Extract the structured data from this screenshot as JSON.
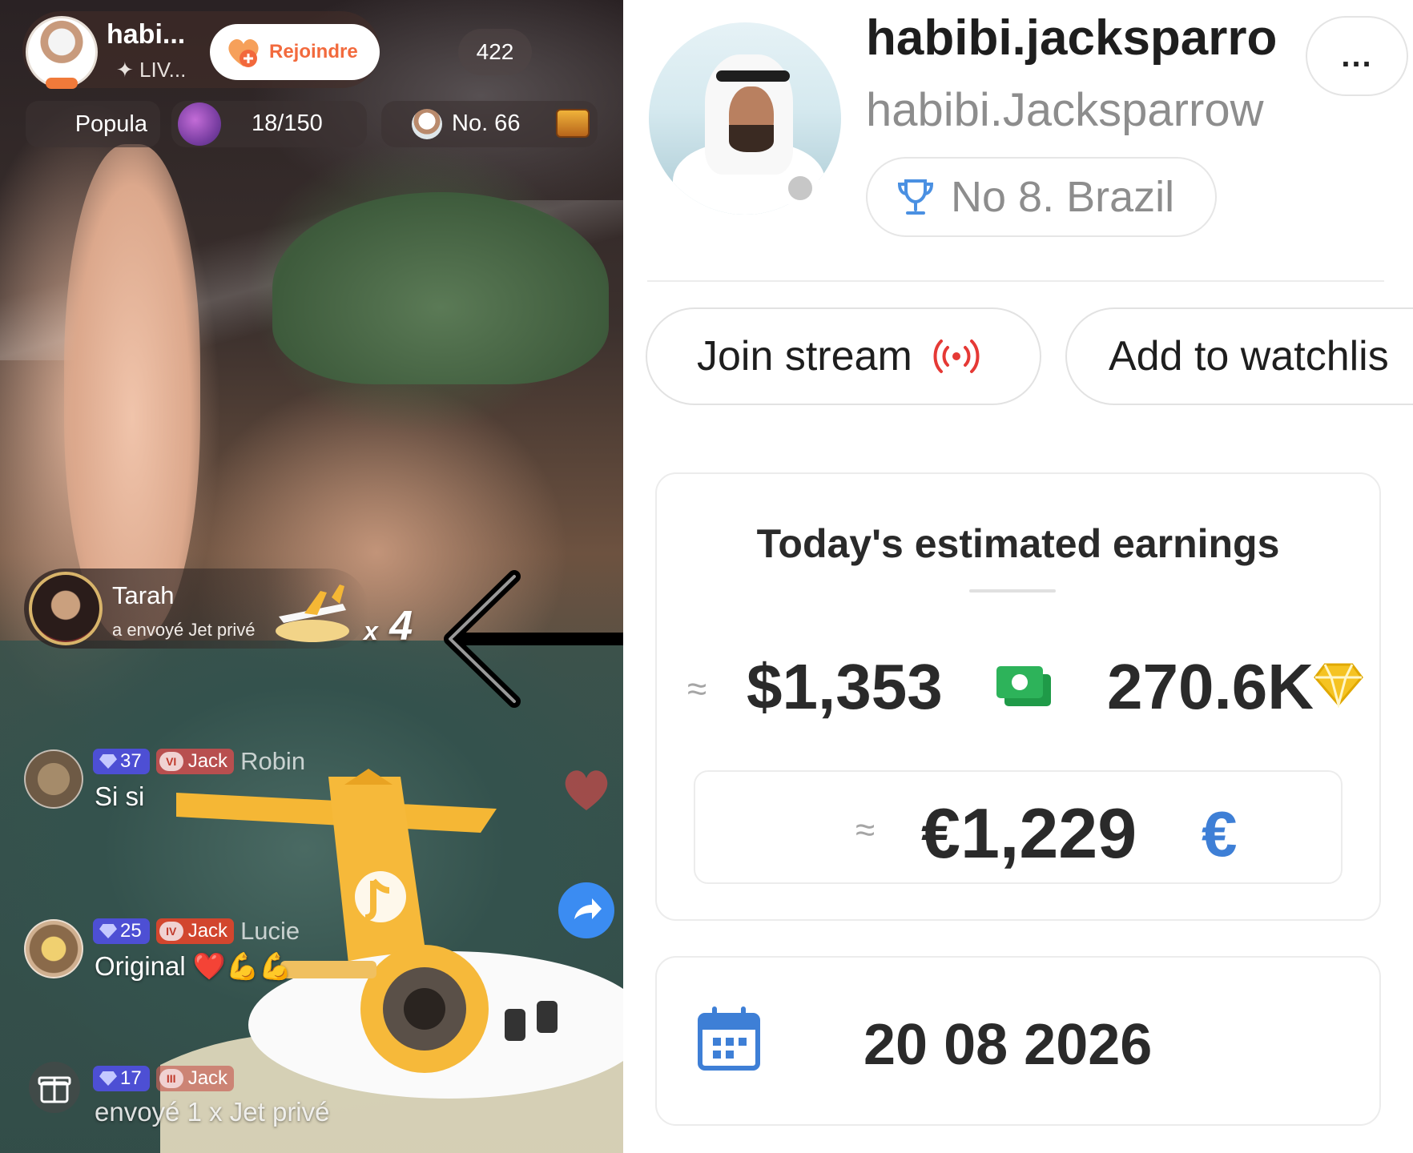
{
  "live": {
    "host_name": "habi...",
    "host_sub": "LIV...",
    "join_label": "Rejoindre",
    "viewer_count": "422",
    "popula_label": "Popula",
    "rank_progress": "18/150",
    "rank_no": "No. 66",
    "gift": {
      "sender": "Tarah",
      "message": "a envoyé  Jet privé",
      "multiplier": "x",
      "count": "4"
    },
    "chat": [
      {
        "gem": "37",
        "fan_level": "VI",
        "fan_name": "Jack",
        "user": "Robin",
        "message": "Si si"
      },
      {
        "gem": "25",
        "fan_level": "IV",
        "fan_name": "Jack",
        "user": "Lucie",
        "message": "Original ❤️💪💪"
      },
      {
        "gem": "17",
        "fan_level": "III",
        "fan_name": "Jack",
        "user": "",
        "message": "envoyé 1 x Jet privé"
      }
    ],
    "icons": [
      "gift-icon",
      "share-icon",
      "heart-icon",
      "jet-icon",
      "chest-icon"
    ]
  },
  "profile": {
    "display_name": "habibi.jacksparro",
    "handle": "habibi.Jacksparrow",
    "more_label": "...",
    "rank_label": "No 8. Brazil",
    "join_stream_label": "Join stream",
    "watchlist_label": "Add to watchlis",
    "earnings_title": "Today's estimated earnings",
    "approx_symbol": "≈",
    "usd_value": "$1,353",
    "diamonds_value": "270.6K",
    "eur_value": "€1,229",
    "eur_symbol": "€",
    "date": "20 08 2026",
    "colors": {
      "live_red": "#e53935",
      "cash_green": "#2db35a",
      "gem_yellow": "#f5c322",
      "euro_blue": "#3e7fd6",
      "calendar_blue": "#3e7fd6",
      "trophy_blue": "#4a90e2"
    },
    "icons": [
      "trophy-icon",
      "live-broadcast-icon",
      "cash-icon",
      "diamond-icon",
      "calendar-icon"
    ]
  }
}
